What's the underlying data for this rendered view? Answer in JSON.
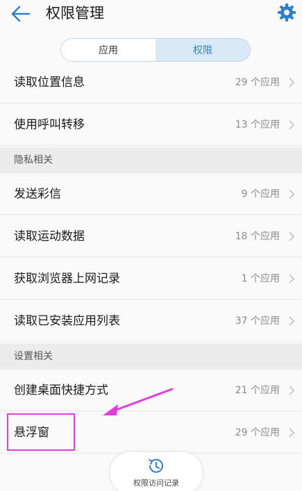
{
  "header": {
    "title": "权限管理",
    "back_icon": "arrow-left-icon",
    "settings_icon": "gear-icon",
    "accent_color": "#2f7fc6"
  },
  "segmented": {
    "tab_apps": "应用",
    "tab_permissions": "权限",
    "selected": "权限"
  },
  "group1": {
    "items": [
      {
        "label": "读取位置信息",
        "count": "29 个应用"
      },
      {
        "label": "使用呼叫转移",
        "count": "13 个应用"
      }
    ]
  },
  "group2": {
    "header": "隐私相关",
    "items": [
      {
        "label": "发送彩信",
        "count": "9 个应用"
      },
      {
        "label": "读取运动数据",
        "count": "18 个应用"
      },
      {
        "label": "获取浏览器上网记录",
        "count": "1 个应用"
      },
      {
        "label": "读取已安装应用列表",
        "count": "37 个应用"
      }
    ]
  },
  "group3": {
    "header": "设置相关",
    "items": [
      {
        "label": "创建桌面快捷方式",
        "count": "21 个应用"
      },
      {
        "label": "悬浮窗",
        "count": "29 个应用"
      }
    ]
  },
  "annotation": {
    "highlight_color": "#e63ae0"
  },
  "fab": {
    "label": "权限访问记录",
    "icon": "history-clock-icon"
  }
}
